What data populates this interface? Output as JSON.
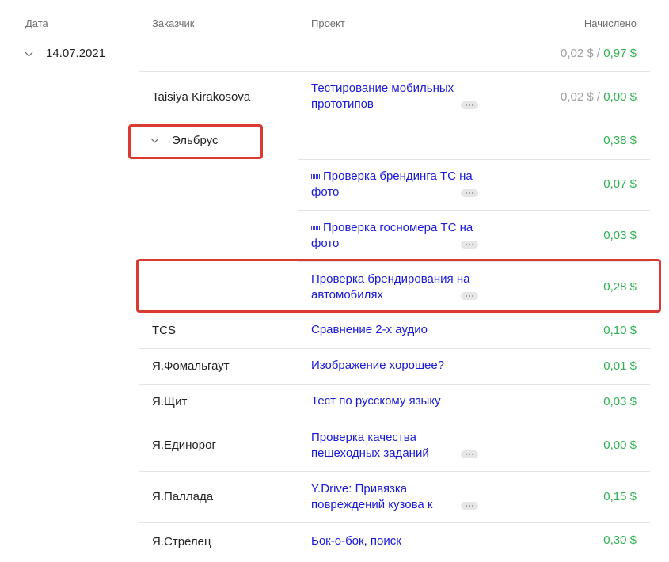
{
  "headers": {
    "date": "Дата",
    "client": "Заказчик",
    "project": "Проект",
    "amount": "Начислено"
  },
  "date_group": {
    "date": "14.07.2021",
    "amount_grey": "0,02 $",
    "separator": " / ",
    "amount_green": "0,97 $"
  },
  "rows": {
    "r1": {
      "client": "Taisiya Kirakosova",
      "project": "Тестирование мобильных прототипов",
      "amount_grey": "0,02 $",
      "separator": " / ",
      "amount_green": "0,00 $"
    },
    "group": {
      "name": "Эльбрус",
      "amount": "0,38 $"
    },
    "g1": {
      "project": "Проверка брендинга ТС на фото",
      "amount": "0,07 $"
    },
    "g2": {
      "project": "Проверка госномера ТС на фото",
      "amount": "0,03 $"
    },
    "g3": {
      "project": "Проверка брендирования на автомобилях",
      "amount": "0,28 $"
    },
    "r2": {
      "client": "TCS",
      "project": "Сравнение 2-х аудио",
      "amount": "0,10 $"
    },
    "r3": {
      "client": "Я.Фомальгаут",
      "project": "Изображение хорошее?",
      "amount": "0,01 $"
    },
    "r4": {
      "client": "Я.Щит",
      "project": "Тест по русскому языку",
      "amount": "0,03 $"
    },
    "r5": {
      "client": "Я.Единорог",
      "project": "Проверка качества пешеходных заданий",
      "amount": "0,00 $"
    },
    "r6": {
      "client": "Я.Паллада",
      "project": "Y.Drive: Привязка повреждений кузова к",
      "amount": "0,15 $"
    },
    "r7": {
      "client": "Я.Стрелец",
      "project": "Бок-о-бок, поиск",
      "amount": "0,30 $"
    }
  },
  "icons": {
    "expand": "chevron-down-icon",
    "more": "more-dots-icon",
    "project_thumb": "project-thumbnail-icon"
  },
  "colors": {
    "positive_amount": "#2eb24f",
    "muted_amount": "#a0a0a0",
    "link": "#1a1ad6",
    "highlight": "#d93a32"
  }
}
